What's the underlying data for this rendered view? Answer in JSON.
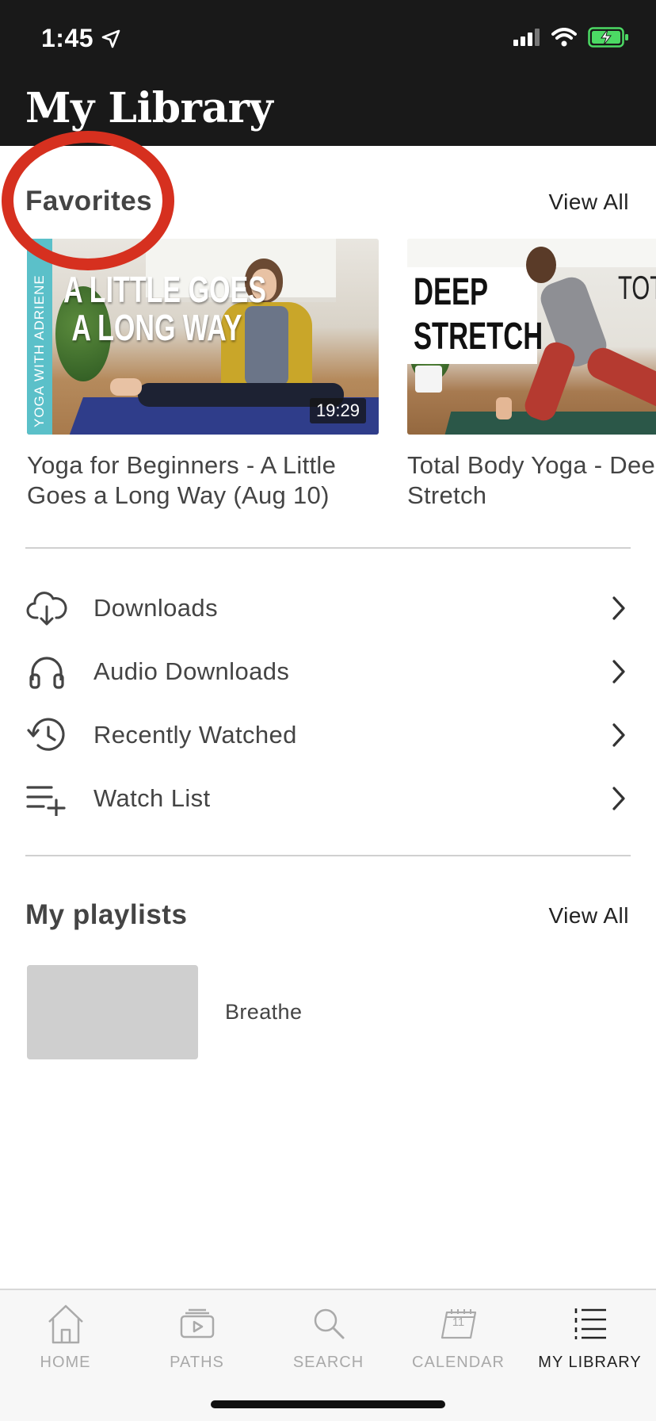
{
  "status_bar": {
    "time": "1:45"
  },
  "header": {
    "title": "My Library"
  },
  "favorites": {
    "title": "Favorites",
    "view_all": "View All",
    "cards": [
      {
        "title_line1": "Yoga for Beginners - A Little",
        "title_line2": "Goes a Long Way (Aug 10)",
        "duration": "19:29",
        "thumb_line1": "A LITTLE GOES",
        "thumb_line2": "A LONG WAY",
        "thumb_side": "YOGA WITH ADRIENE"
      },
      {
        "title_line1": "Total Body Yoga - Deep",
        "title_line2": "Stretch",
        "thumb_line1": "DEEP",
        "thumb_line2": "STRETCH",
        "thumb_corner": "TOTAL"
      }
    ]
  },
  "menu": [
    {
      "label": "Downloads",
      "icon": "cloud-download-icon"
    },
    {
      "label": "Audio Downloads",
      "icon": "headphones-icon"
    },
    {
      "label": "Recently Watched",
      "icon": "history-icon"
    },
    {
      "label": "Watch List",
      "icon": "playlist-add-icon"
    }
  ],
  "playlists": {
    "title": "My playlists",
    "view_all": "View All",
    "items": [
      {
        "name": "Breathe"
      }
    ]
  },
  "tabbar": {
    "tabs": [
      {
        "label": "HOME",
        "icon": "home-icon"
      },
      {
        "label": "PATHS",
        "icon": "paths-icon"
      },
      {
        "label": "SEARCH",
        "icon": "search-icon"
      },
      {
        "label": "CALENDAR",
        "icon": "calendar-icon",
        "day": "11"
      },
      {
        "label": "MY LIBRARY",
        "icon": "library-icon",
        "active": true
      }
    ]
  },
  "colors": {
    "header_bg": "#191919",
    "annotation": "#d6301f",
    "battery": "#4cd964"
  }
}
